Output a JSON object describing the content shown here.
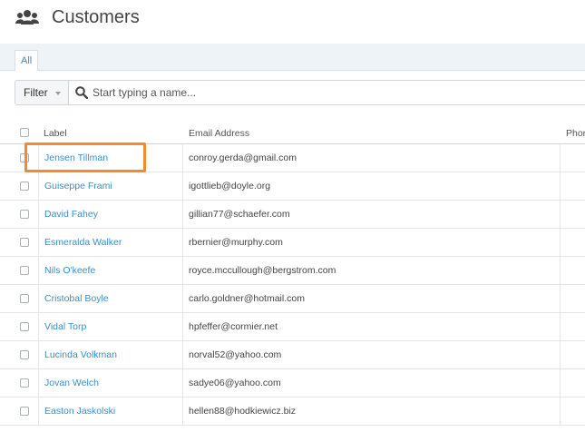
{
  "header": {
    "title": "Customers",
    "icon": "users-icon"
  },
  "tabs": [
    {
      "label": "All"
    }
  ],
  "filter": {
    "button_label": "Filter",
    "search_placeholder": "Start typing a name..."
  },
  "table": {
    "columns": [
      "Label",
      "Email Address",
      "Phone"
    ],
    "rows": [
      {
        "label": "Jensen Tillman",
        "email": "conroy.gerda@gmail.com"
      },
      {
        "label": "Guiseppe Frami",
        "email": "igottlieb@doyle.org"
      },
      {
        "label": "David Fahey",
        "email": "gillian77@schaefer.com"
      },
      {
        "label": "Esmeralda Walker",
        "email": "rbernier@murphy.com"
      },
      {
        "label": "Nils O'keefe",
        "email": "royce.mccullough@bergstrom.com"
      },
      {
        "label": "Cristobal Boyle",
        "email": "carlo.goldner@hotmail.com"
      },
      {
        "label": "Vidal Torp",
        "email": "hpfeffer@cormier.net"
      },
      {
        "label": "Lucinda Volkman",
        "email": "norval52@yahoo.com"
      },
      {
        "label": "Jovan Welch",
        "email": "sadye06@yahoo.com"
      },
      {
        "label": "Easton Jaskolski",
        "email": "hellen88@hodkiewicz.biz"
      }
    ]
  },
  "colors": {
    "accent": "#3a8fc8",
    "highlight": "#f28a30",
    "tabbar_bg": "#edf3f7"
  }
}
